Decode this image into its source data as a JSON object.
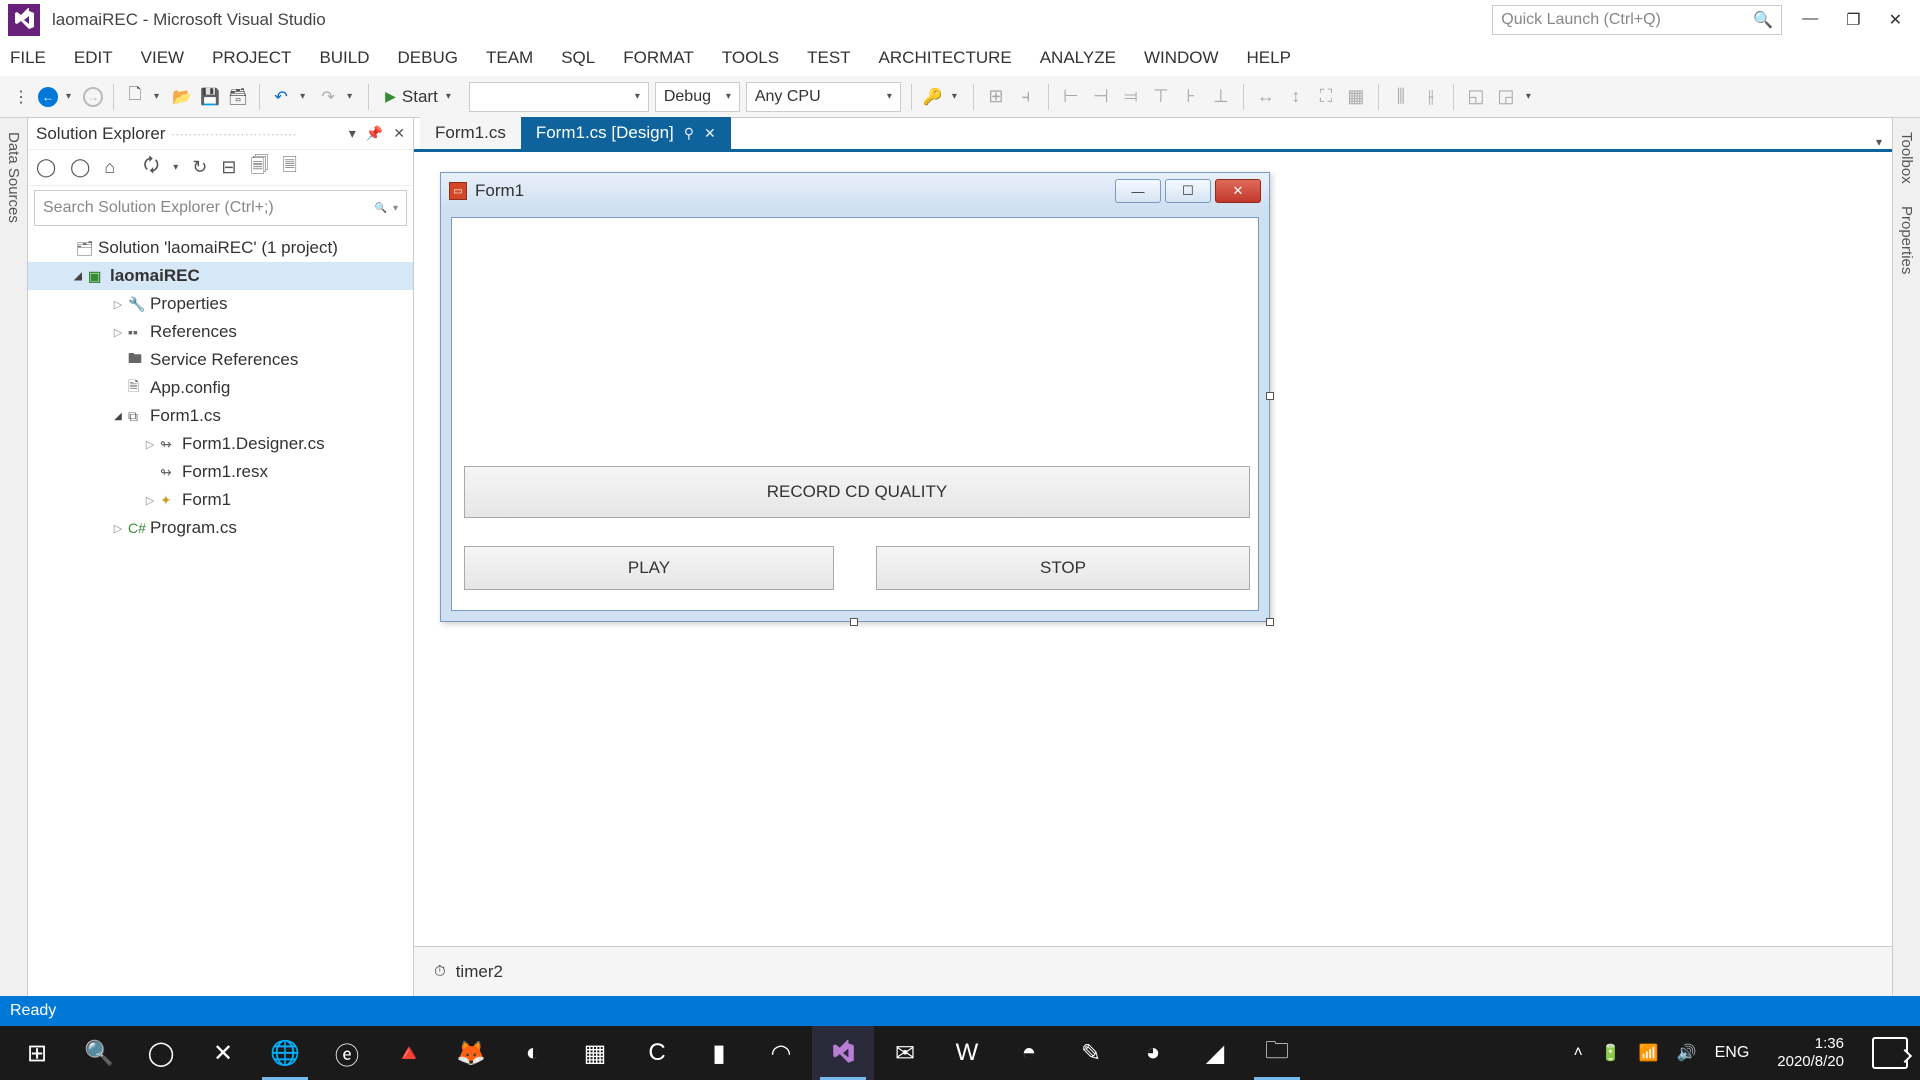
{
  "window": {
    "title": "laomaiREC - Microsoft Visual Studio",
    "quicklaunch_placeholder": "Quick Launch (Ctrl+Q)"
  },
  "menu": [
    "FILE",
    "EDIT",
    "VIEW",
    "PROJECT",
    "BUILD",
    "DEBUG",
    "TEAM",
    "SQL",
    "FORMAT",
    "TOOLS",
    "TEST",
    "ARCHITECTURE",
    "ANALYZE",
    "WINDOW",
    "HELP"
  ],
  "toolbar": {
    "start_label": "Start",
    "config": "Debug",
    "platform": "Any CPU"
  },
  "side_tabs": {
    "left": "Data Sources",
    "right_top": "Toolbox",
    "right_bottom": "Properties"
  },
  "solexp": {
    "title": "Solution Explorer",
    "search_placeholder": "Search Solution Explorer (Ctrl+;)",
    "solution": "Solution 'laomaiREC' (1 project)",
    "project": "laomaiREC",
    "nodes": {
      "properties": "Properties",
      "references": "References",
      "servicerefs": "Service References",
      "appconfig": "App.config",
      "form1cs": "Form1.cs",
      "form1designer": "Form1.Designer.cs",
      "form1resx": "Form1.resx",
      "form1": "Form1",
      "programcs": "Program.cs"
    }
  },
  "tabs": {
    "inactive": "Form1.cs",
    "active": "Form1.cs [Design]"
  },
  "form": {
    "title": "Form1",
    "btn_record": "RECORD CD QUALITY",
    "btn_play": "PLAY",
    "btn_stop": "STOP"
  },
  "component_tray": {
    "timer": "timer2"
  },
  "status": "Ready",
  "systray": {
    "lang": "ENG",
    "time": "1:36",
    "date": "2020/8/20"
  }
}
